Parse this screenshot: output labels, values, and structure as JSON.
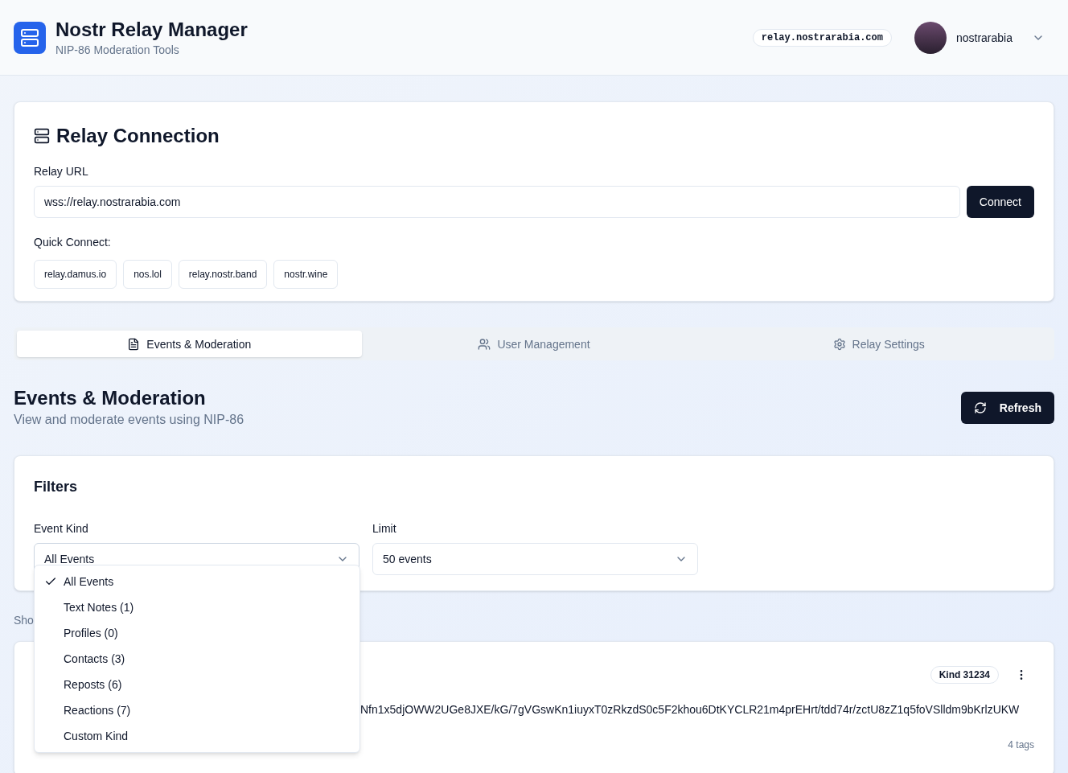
{
  "header": {
    "title": "Nostr Relay Manager",
    "subtitle": "NIP-86 Moderation Tools",
    "relay_badge": "relay.nostrarabia.com",
    "user": {
      "name": "nostrarabia"
    }
  },
  "connection": {
    "title": "Relay Connection",
    "url_label": "Relay URL",
    "url_value": "wss://relay.nostrarabia.com",
    "connect_button": "Connect",
    "quick_label": "Quick Connect:",
    "quick_relays": [
      "relay.damus.io",
      "nos.lol",
      "relay.nostr.band",
      "nostr.wine"
    ]
  },
  "tabs": [
    {
      "label": "Events & Moderation",
      "selected": true
    },
    {
      "label": "User Management",
      "selected": false
    },
    {
      "label": "Relay Settings",
      "selected": false
    }
  ],
  "section": {
    "title": "Events & Moderation",
    "subtitle": "View and moderate events using NIP-86",
    "refresh_button": "Refresh"
  },
  "filters": {
    "title": "Filters",
    "event_kind": {
      "label": "Event Kind",
      "value": "All Events",
      "expanded": true,
      "options": [
        {
          "label": "All Events",
          "selected": true
        },
        {
          "label": "Text Notes (1)",
          "selected": false
        },
        {
          "label": "Profiles (0)",
          "selected": false
        },
        {
          "label": "Contacts (3)",
          "selected": false
        },
        {
          "label": "Reposts (6)",
          "selected": false
        },
        {
          "label": "Reactions (7)",
          "selected": false
        },
        {
          "label": "Custom Kind",
          "selected": false
        }
      ]
    },
    "limit": {
      "label": "Limit",
      "value": "50 events"
    }
  },
  "showing_text": "Sho",
  "event": {
    "kind_badge": "Kind 31234",
    "content": "Nfn1x5djOWW2UGe8JXE/kG/7gVGswKn1iuyxT0zRkzdS0c5F2khou6DtKYCLR21m4prEHrt/tdd74r/zctU8zZ1q5foVSlldm9bKrlzUKW",
    "tags": "4 tags"
  }
}
